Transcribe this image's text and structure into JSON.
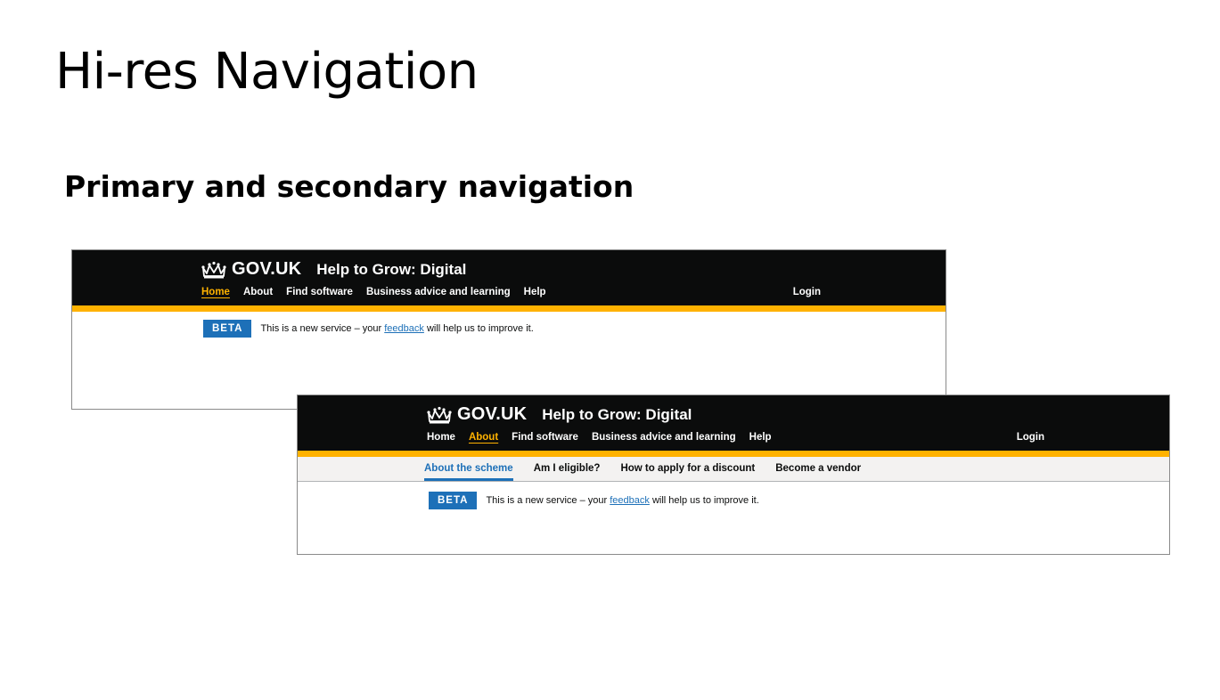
{
  "slide": {
    "title": "Hi-res Navigation",
    "subtitle": "Primary and secondary navigation"
  },
  "shot1": {
    "logo": "GOV.UK",
    "service": "Help to Grow: Digital",
    "nav": [
      "Home",
      "About",
      "Find software",
      "Business advice and learning",
      "Help"
    ],
    "active_nav": "Home",
    "login": "Login",
    "beta": "BETA",
    "banner_pre": "This is a new service – your",
    "banner_link": "feedback",
    "banner_post": "will help us to improve it."
  },
  "shot2": {
    "logo": "GOV.UK",
    "service": "Help to Grow: Digital",
    "nav": [
      "Home",
      "About",
      "Find software",
      "Business advice and learning",
      "Help"
    ],
    "active_nav": "About",
    "login": "Login",
    "subnav": [
      "About the scheme",
      "Am I eligible?",
      "How to apply for a discount",
      "Become a vendor"
    ],
    "active_subnav": "About the scheme",
    "beta": "BETA",
    "banner_pre": "This is a new service – your",
    "banner_link": "feedback",
    "banner_post": "will help us to improve it."
  },
  "colors": {
    "header_bg": "#0b0c0c",
    "accent_yellow": "#ffb200",
    "link_blue": "#1d70b8",
    "subnav_bg": "#f3f2f1"
  },
  "icons": {
    "logo": "crown-icon"
  }
}
